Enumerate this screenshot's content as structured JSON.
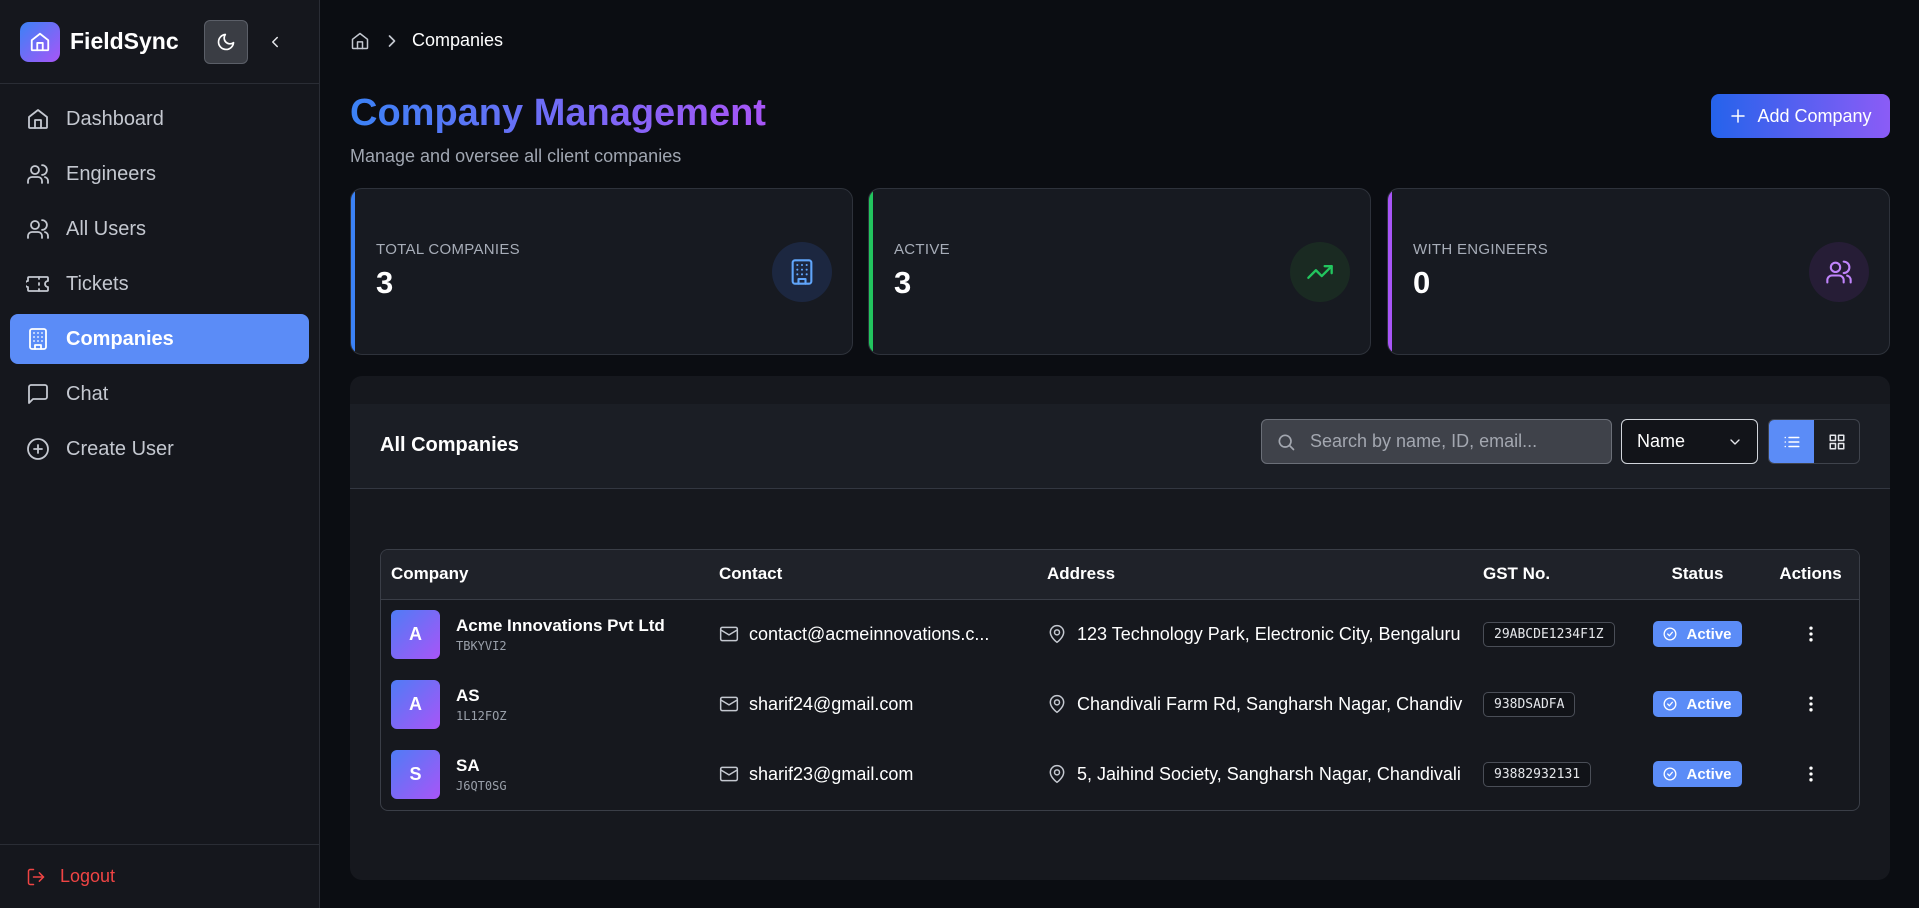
{
  "app": {
    "name": "FieldSync"
  },
  "sidebar": {
    "items": [
      {
        "label": "Dashboard",
        "icon": "home-icon"
      },
      {
        "label": "Engineers",
        "icon": "users-icon"
      },
      {
        "label": "All Users",
        "icon": "users-icon"
      },
      {
        "label": "Tickets",
        "icon": "ticket-icon"
      },
      {
        "label": "Companies",
        "icon": "building-icon",
        "active": true
      },
      {
        "label": "Chat",
        "icon": "chat-icon"
      },
      {
        "label": "Create User",
        "icon": "plus-circle-icon"
      }
    ],
    "logout_label": "Logout"
  },
  "breadcrumb": {
    "current": "Companies"
  },
  "header": {
    "title": "Company Management",
    "subtitle": "Manage and oversee all client companies",
    "add_button_label": "Add Company"
  },
  "stats": [
    {
      "label": "TOTAL COMPANIES",
      "value": "3",
      "accent": "#3b82f6",
      "icon": "building-icon"
    },
    {
      "label": "ACTIVE",
      "value": "3",
      "accent": "#22c55e",
      "icon": "trending-up-icon"
    },
    {
      "label": "WITH ENGINEERS",
      "value": "0",
      "accent": "#a855f7",
      "icon": "users-icon"
    }
  ],
  "table": {
    "title": "All Companies",
    "search_placeholder": "Search by name, ID, email...",
    "sort_value": "Name",
    "columns": [
      "Company",
      "Contact",
      "Address",
      "GST No.",
      "Status",
      "Actions"
    ],
    "rows": [
      {
        "initial": "A",
        "name": "Acme Innovations Pvt Ltd",
        "id": "TBKYVI2",
        "email": "contact@acmeinnovations.c...",
        "address": "123 Technology Park, Electronic City, Bengaluru",
        "gst": "29ABCDE1234F1Z",
        "status": "Active"
      },
      {
        "initial": "A",
        "name": "AS",
        "id": "1L12FOZ",
        "email": "sharif24@gmail.com",
        "address": "Chandivali Farm Rd, Sangharsh Nagar, Chandivali",
        "gst": "938DSADFA",
        "status": "Active"
      },
      {
        "initial": "S",
        "name": "SA",
        "id": "J6QT0SG",
        "email": "sharif23@gmail.com",
        "address": "5, Jaihind Society, Sangharsh Nagar, Chandivali",
        "gst": "93882932131",
        "status": "Active"
      }
    ]
  },
  "colors": {
    "primary": "#5b8cf7",
    "gradient_start": "#3b82f6",
    "gradient_end": "#a855f7",
    "danger": "#ef4444"
  }
}
